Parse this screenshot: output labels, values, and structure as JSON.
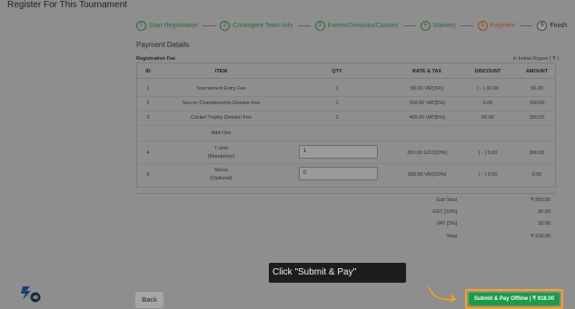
{
  "page": {
    "title": "Register For This Tournament"
  },
  "steps": [
    {
      "num": "1",
      "label": "Start Registration"
    },
    {
      "num": "2",
      "label": "Contingent Team Info"
    },
    {
      "num": "3",
      "label": "Events/Divisions/Classes"
    },
    {
      "num": "4",
      "label": "Waivers"
    },
    {
      "num": "5",
      "label": "Payment"
    },
    {
      "num": "6",
      "label": "Finish"
    }
  ],
  "payment": {
    "section_title": "Payment Details",
    "registration_fee_label": "Registration Fee",
    "currency_note": "in Indian Rupee ( ₹ )",
    "headers": {
      "id": "ID",
      "item": "ITEM",
      "qty": "QTY",
      "rate": "RATE & TAX",
      "discount": "DISCOUNT",
      "amount": "AMOUNT"
    },
    "rows": [
      {
        "id": "1",
        "item": "Tournament Entry Fee",
        "qty": "1",
        "rate": "80.00 VAT[5%]",
        "discount": "( - ) 30.00",
        "amount": "50.00"
      },
      {
        "id": "2",
        "item": "Soccer Championship Division Fee",
        "qty": "1",
        "rate": "150.00 VAT[5%]",
        "discount": "0.00",
        "amount": "150.00"
      },
      {
        "id": "3",
        "item": "Cricket Trophy Division Fee",
        "qty": "1",
        "rate": "400.00 VAT[5%]",
        "discount": "50.00",
        "amount": "350.00"
      }
    ],
    "addons_label": "Add-Ons",
    "addons": [
      {
        "id": "4",
        "item": "T-shirt",
        "note": "(Mandatory)",
        "qty": "1",
        "rate": "300.00 GST[10%]",
        "discount": "( - ) 0.00",
        "amount": "300.00"
      },
      {
        "id": "5",
        "item": "Shoes",
        "note": "(Optional)",
        "qty": "0",
        "rate": "500.00 VAT[20%]",
        "discount": "( - ) 0.00",
        "amount": "0.00"
      }
    ],
    "totals": [
      {
        "label": "Sub Total",
        "value": "₹ 850.00"
      },
      {
        "label": "GST [10%]",
        "value": "30.00"
      },
      {
        "label": "VAT [5%]",
        "value": "28.00"
      },
      {
        "label": "Total",
        "value": "₹ 918.00"
      }
    ]
  },
  "tooltip": {
    "text": "Click \"Submit & Pay\""
  },
  "buttons": {
    "pay_label": "Submit & Pay Offline | ₹ 918.00",
    "back_label": "Back"
  },
  "logo": {
    "badge": "49"
  },
  "colors": {
    "accent_green": "#1f9a47",
    "highlight_orange": "#f5a51f",
    "active_step": "#a04a23"
  }
}
